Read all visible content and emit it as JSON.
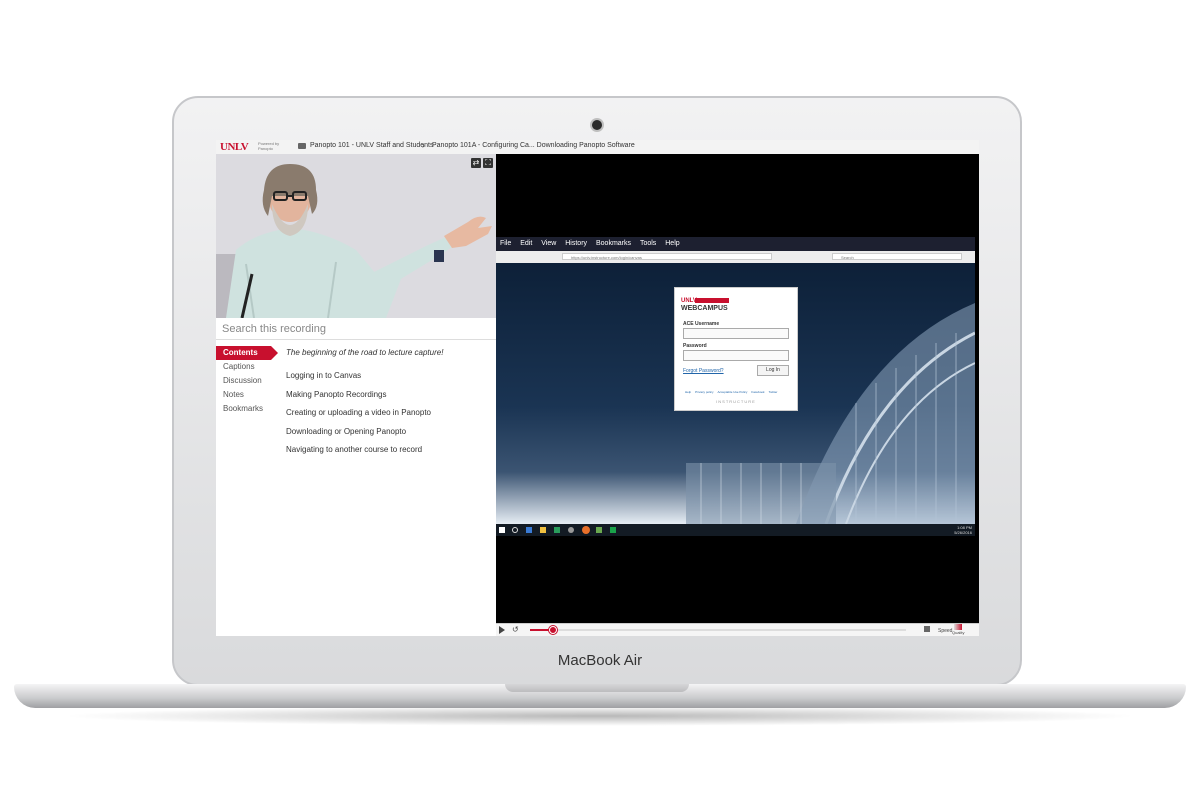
{
  "device": {
    "label": "MacBook Air"
  },
  "panopto": {
    "logo_text": "UNLV",
    "powered_by": "Powered by Panopto",
    "breadcrumb": {
      "folder": "Panopto 101 - UNLV Staff and Students",
      "separator": "›",
      "current": "Panopto 101A - Configuring Ca... Downloading Panopto Software"
    },
    "search_placeholder": "Search this recording",
    "nav": {
      "items": [
        "Contents",
        "Captions",
        "Discussion",
        "Notes",
        "Bookmarks"
      ],
      "active": "Contents"
    },
    "contents": {
      "intro": "The beginning of the road to lecture capture!",
      "items": [
        "Logging in to Canvas",
        "Making Panopto Recordings",
        "Creating or uploading a video in Panopto",
        "Downloading or Opening Panopto",
        "Navigating to another course to record"
      ]
    }
  },
  "screen_capture": {
    "menu": [
      "File",
      "Edit",
      "View",
      "History",
      "Bookmarks",
      "Tools",
      "Help"
    ],
    "url": "https://unlv.instructure.com/login/canvas",
    "search_placeholder": "Search",
    "login": {
      "brand_top": "UNLV",
      "brand_bottom": "WEBCAMPUS",
      "username_label": "ACE Username",
      "password_label": "Password",
      "forgot": "Forgot Password?",
      "login_button": "Log In",
      "footer_links": [
        "Help",
        "Privacy policy",
        "Acceptable Use Policy",
        "Facebook",
        "Twitter"
      ],
      "footer_brand": "INSTRUCTURE"
    },
    "clock": {
      "time": "1:08 PM",
      "date": "5/26/2016"
    }
  },
  "player": {
    "progress": 0.06,
    "speed": "Speed",
    "quality": "Quality"
  },
  "colors": {
    "accent": "#c8102e",
    "video_bg": "#000000"
  }
}
